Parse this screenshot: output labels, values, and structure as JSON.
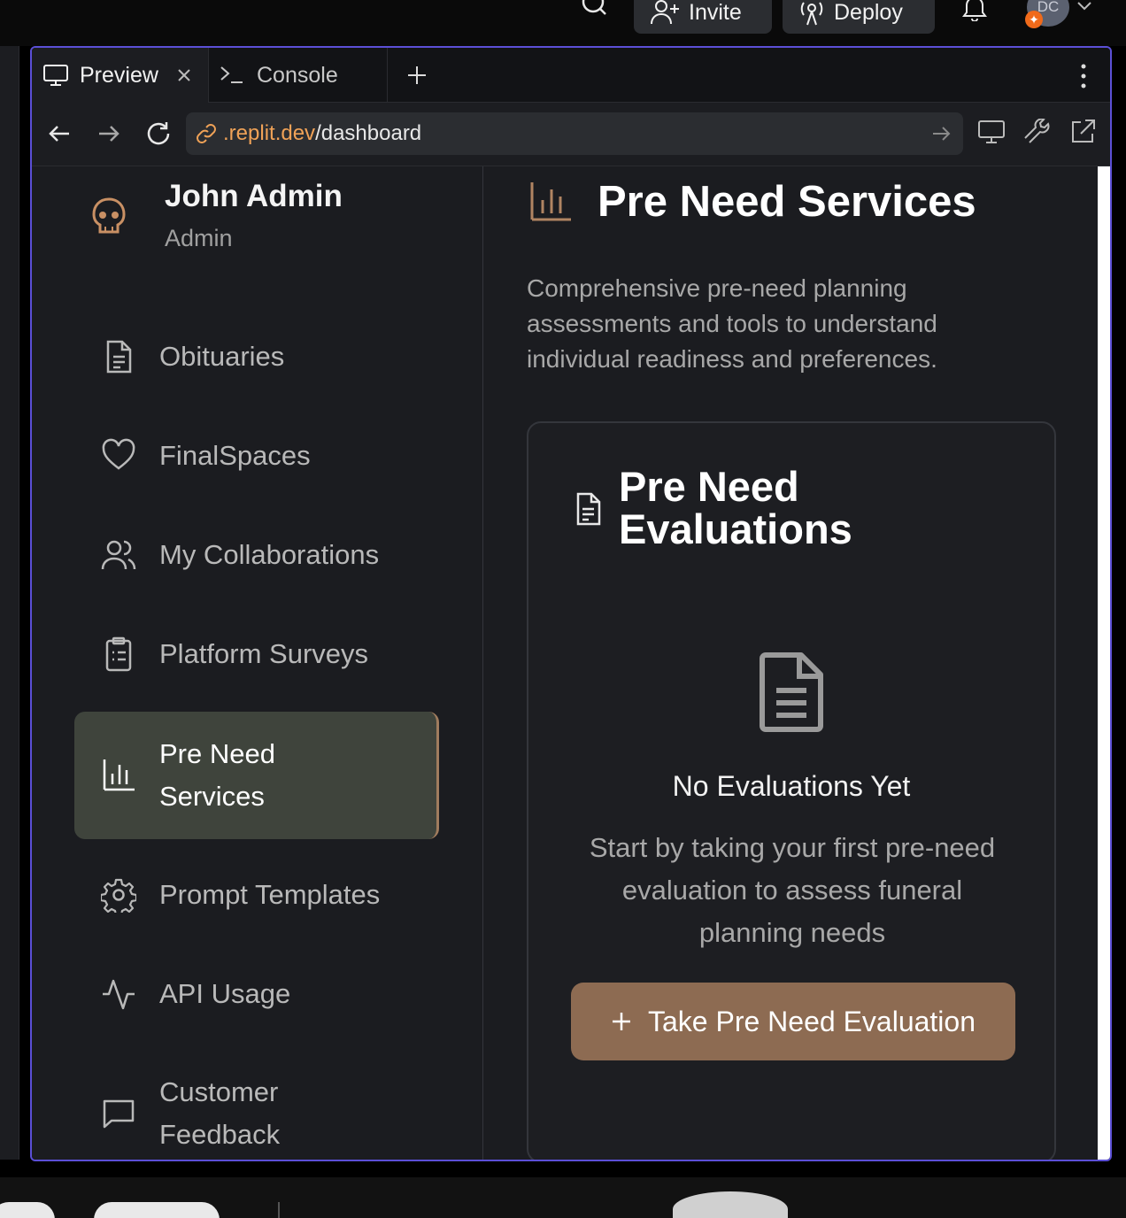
{
  "topbar": {
    "invite_label": "Invite",
    "deploy_label": "Deploy",
    "avatar_initials": "DC",
    "icons": [
      "search-icon",
      "invite-icon",
      "deploy-icon",
      "bell-icon",
      "chevron-down-icon"
    ]
  },
  "tabs": [
    {
      "label": "Preview",
      "icon": "monitor-icon",
      "closable": true
    },
    {
      "label": "Console",
      "icon": "terminal-icon"
    }
  ],
  "urlbar": {
    "domain": ".replit.dev",
    "path": "/dashboard"
  },
  "sidebar": {
    "user_name": "John Admin",
    "user_role": "Admin",
    "items": [
      {
        "label": "Obituaries",
        "icon": "document-icon"
      },
      {
        "label": "FinalSpaces",
        "icon": "heart-icon"
      },
      {
        "label": "My Collaborations",
        "icon": "users-icon"
      },
      {
        "label": "Platform Surveys",
        "icon": "clipboard-icon"
      },
      {
        "label": "Pre Need Services",
        "icon": "bar-chart-icon",
        "active": true
      },
      {
        "label": "Prompt Templates",
        "icon": "gear-icon"
      },
      {
        "label": "API Usage",
        "icon": "activity-icon"
      },
      {
        "label": "Customer Feedback",
        "icon": "message-icon"
      }
    ]
  },
  "main": {
    "title": "Pre Need Services",
    "description": "Comprehensive pre-need planning assessments and tools to understand individual readiness and preferences.",
    "card": {
      "title": "Pre Need Evaluations",
      "empty_title": "No Evaluations Yet",
      "empty_desc": "Start by taking your first pre-need evaluation to assess funeral planning needs",
      "cta_label": "Take Pre Need Evaluation"
    }
  },
  "colors": {
    "accent": "#8d6b52",
    "active_nav_bg": "#3f443c",
    "pane_border": "#5b4fd6",
    "url_domain": "#f0a257"
  }
}
